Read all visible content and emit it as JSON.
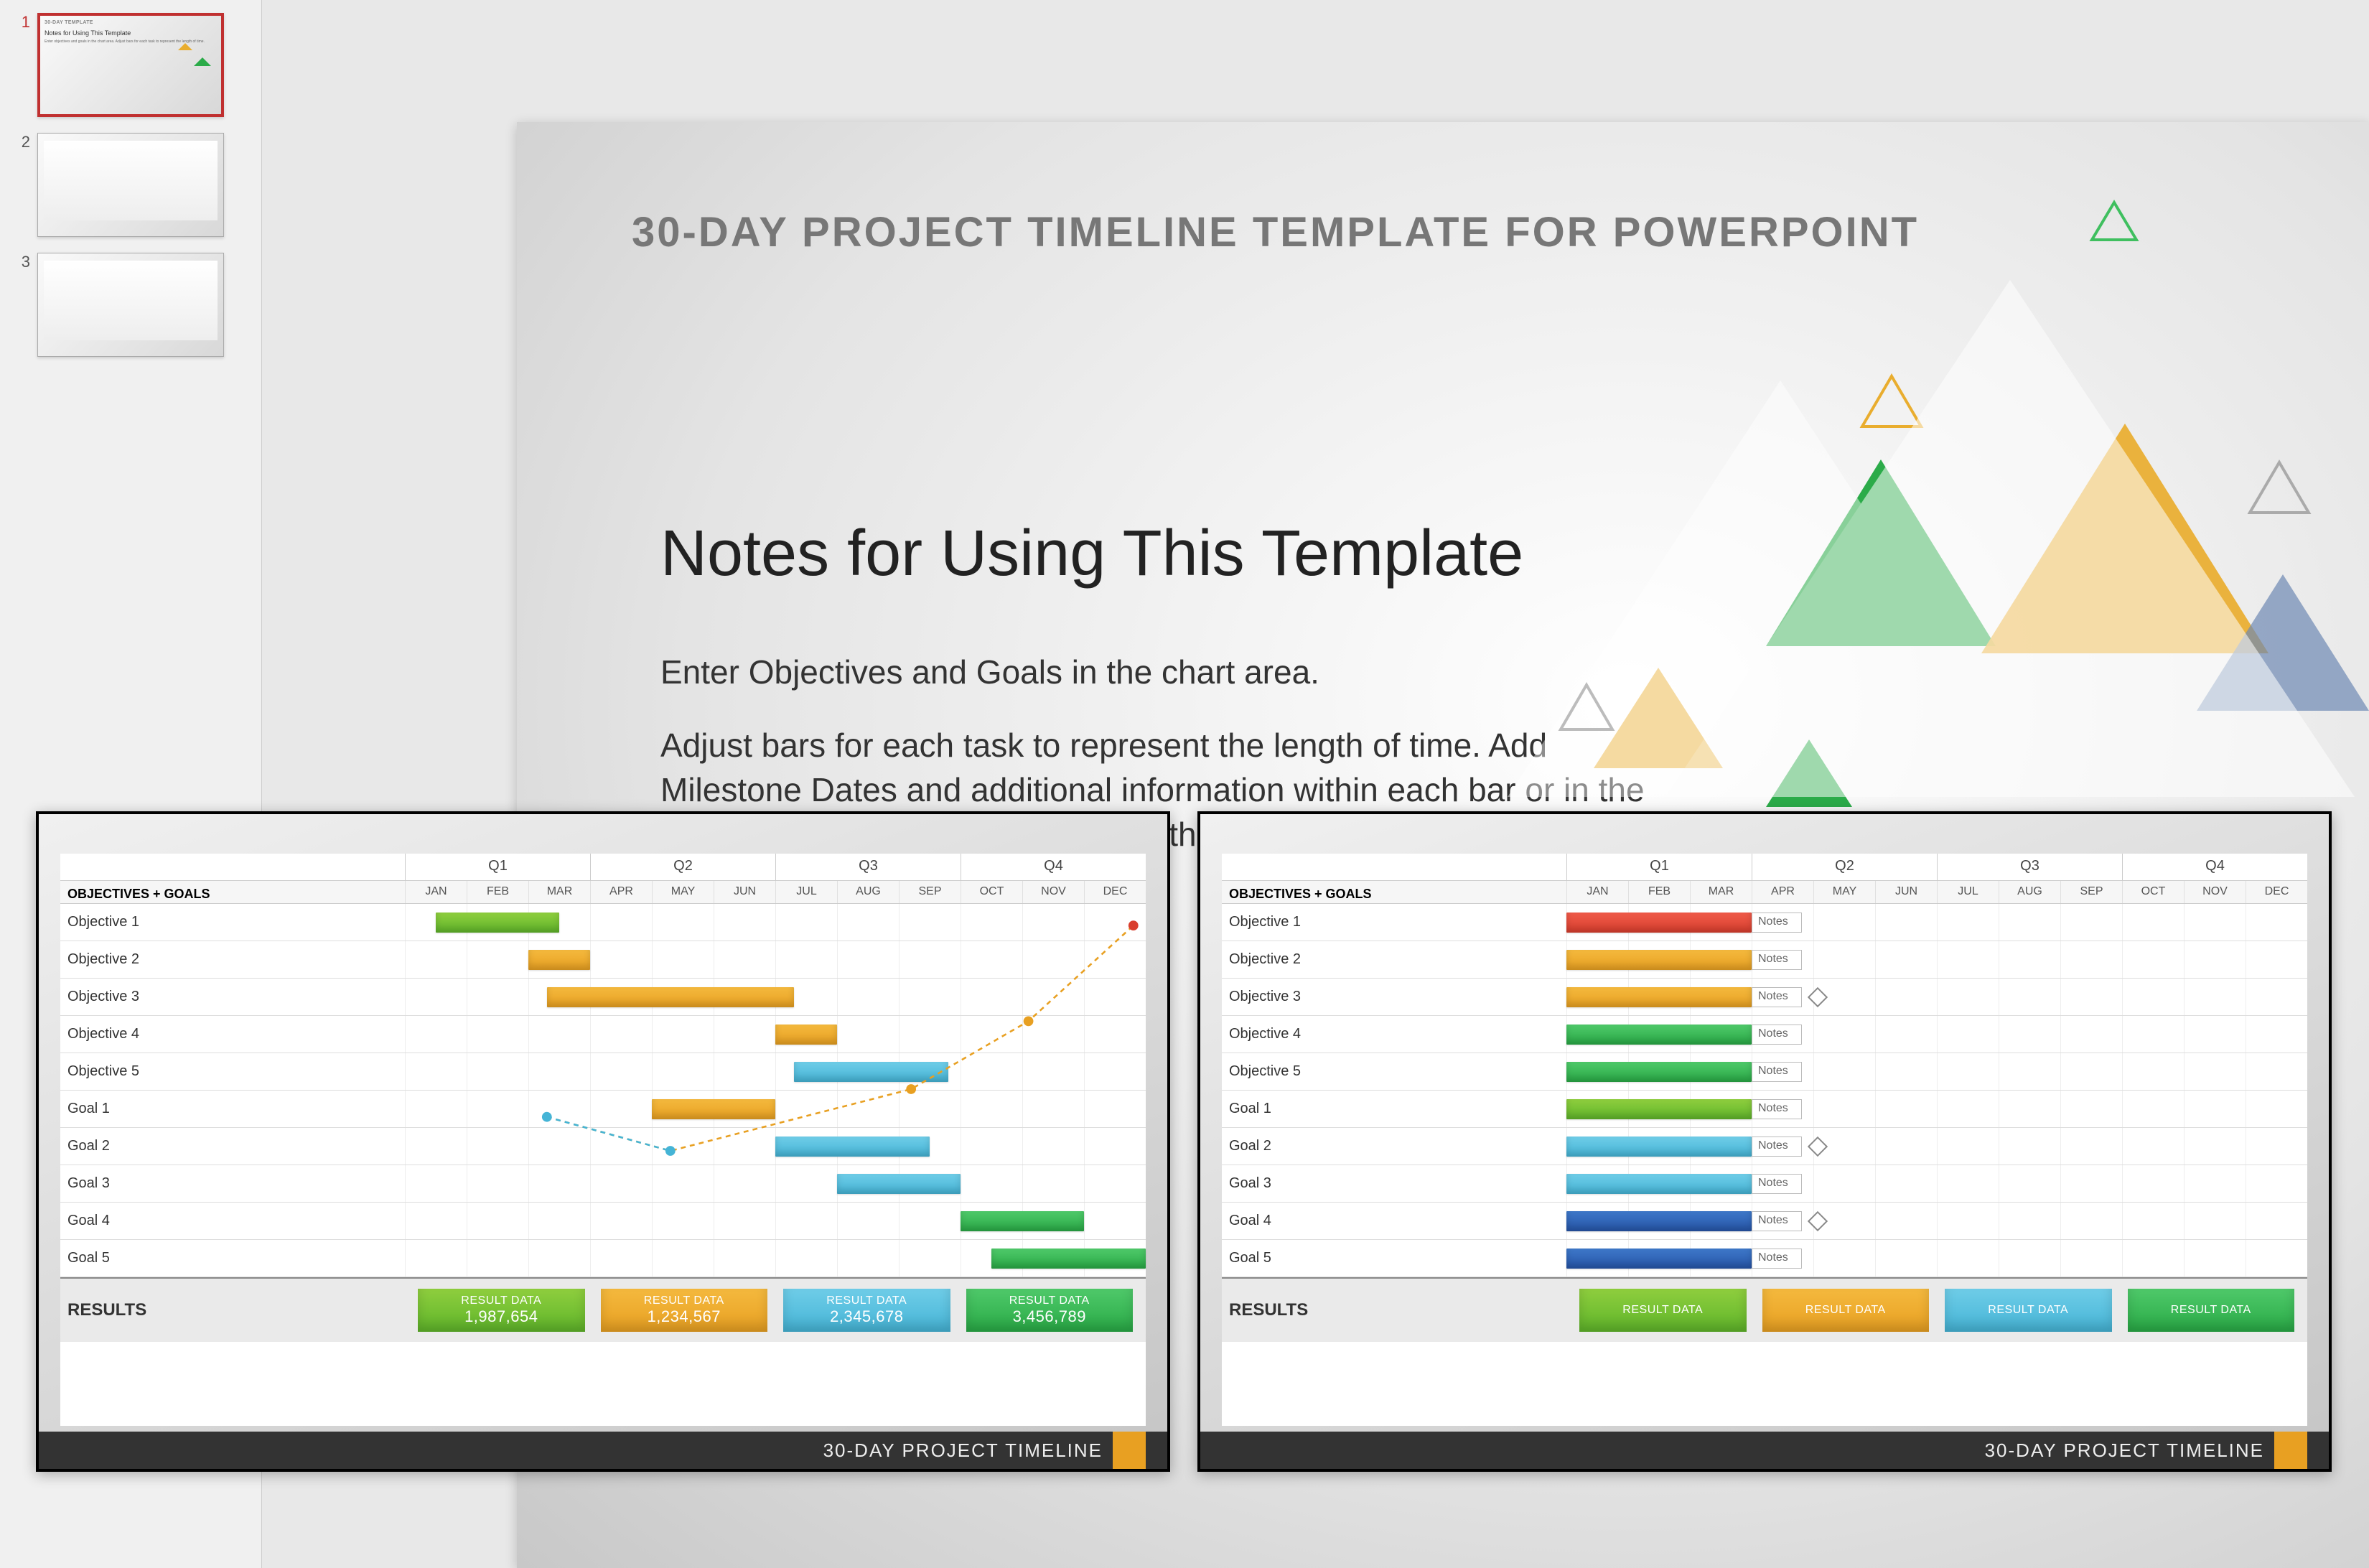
{
  "thumbs": {
    "n1": "1",
    "n2": "2",
    "n3": "3"
  },
  "slide": {
    "title": "30-DAY PROJECT TIMELINE TEMPLATE FOR POWERPOINT",
    "heading": "Notes for Using This Template",
    "p1": "Enter Objectives and Goals in the chart area.",
    "p2": "Adjust bars for each task to represent the length of time.  Add Milestone Dates and additional information within each bar or in the graph area. Summarize Results in the bottom row."
  },
  "footer": "30-DAY PROJECT TIMELINE",
  "chart": {
    "header_label": "OBJECTIVES + GOALS",
    "quarters": [
      "Q1",
      "Q2",
      "Q3",
      "Q4"
    ],
    "months": [
      "JAN",
      "FEB",
      "MAR",
      "APR",
      "MAY",
      "JUN",
      "JUL",
      "AUG",
      "SEP",
      "OCT",
      "NOV",
      "DEC"
    ],
    "rows": [
      "Objective 1",
      "Objective 2",
      "Objective 3",
      "Objective 4",
      "Objective 5",
      "Goal 1",
      "Goal 2",
      "Goal 3",
      "Goal 4",
      "Goal 5"
    ],
    "results_label": "RESULTS",
    "result_title": "RESULT DATA",
    "note_label": "Notes"
  },
  "chartA": {
    "bars": [
      {
        "row": 0,
        "start": 0.5,
        "span": 2,
        "cls": "g-green"
      },
      {
        "row": 1,
        "start": 2,
        "span": 1,
        "cls": "g-orange"
      },
      {
        "row": 2,
        "start": 2.3,
        "span": 4,
        "cls": "g-orange"
      },
      {
        "row": 3,
        "start": 6,
        "span": 1,
        "cls": "g-orange"
      },
      {
        "row": 4,
        "start": 6.3,
        "span": 2.5,
        "cls": "g-blue"
      },
      {
        "row": 5,
        "start": 4,
        "span": 2,
        "cls": "g-orange"
      },
      {
        "row": 6,
        "start": 6,
        "span": 2.5,
        "cls": "g-blue"
      },
      {
        "row": 7,
        "start": 7,
        "span": 2,
        "cls": "g-blue"
      },
      {
        "row": 8,
        "start": 9,
        "span": 2,
        "cls": "g-green2"
      },
      {
        "row": 9,
        "start": 9.5,
        "span": 2.5,
        "cls": "g-green2"
      }
    ],
    "results": [
      {
        "cls": "g-green",
        "val": "1,987,654"
      },
      {
        "cls": "g-orange",
        "val": "1,234,567"
      },
      {
        "cls": "g-blue",
        "val": "2,345,678"
      },
      {
        "cls": "g-green2",
        "val": "3,456,789"
      }
    ]
  },
  "chartB": {
    "bars": [
      {
        "row": 0,
        "start": 0,
        "span": 3,
        "cls": "g-red"
      },
      {
        "row": 1,
        "start": 0,
        "span": 3,
        "cls": "g-orange"
      },
      {
        "row": 2,
        "start": 0,
        "span": 3,
        "cls": "g-orange"
      },
      {
        "row": 3,
        "start": 0,
        "span": 3,
        "cls": "g-green2"
      },
      {
        "row": 4,
        "start": 0,
        "span": 3,
        "cls": "g-green2"
      },
      {
        "row": 5,
        "start": 0,
        "span": 3,
        "cls": "g-green"
      },
      {
        "row": 6,
        "start": 0,
        "span": 3,
        "cls": "g-blue"
      },
      {
        "row": 7,
        "start": 0,
        "span": 3,
        "cls": "g-blue"
      },
      {
        "row": 8,
        "start": 0,
        "span": 3,
        "cls": "g-navy"
      },
      {
        "row": 9,
        "start": 0,
        "span": 3,
        "cls": "g-navy"
      }
    ],
    "milestones": [
      2,
      6,
      8
    ],
    "results": [
      {
        "cls": "g-green",
        "val": ""
      },
      {
        "cls": "g-orange",
        "val": ""
      },
      {
        "cls": "g-blue",
        "val": ""
      },
      {
        "cls": "g-green2",
        "val": ""
      }
    ]
  }
}
